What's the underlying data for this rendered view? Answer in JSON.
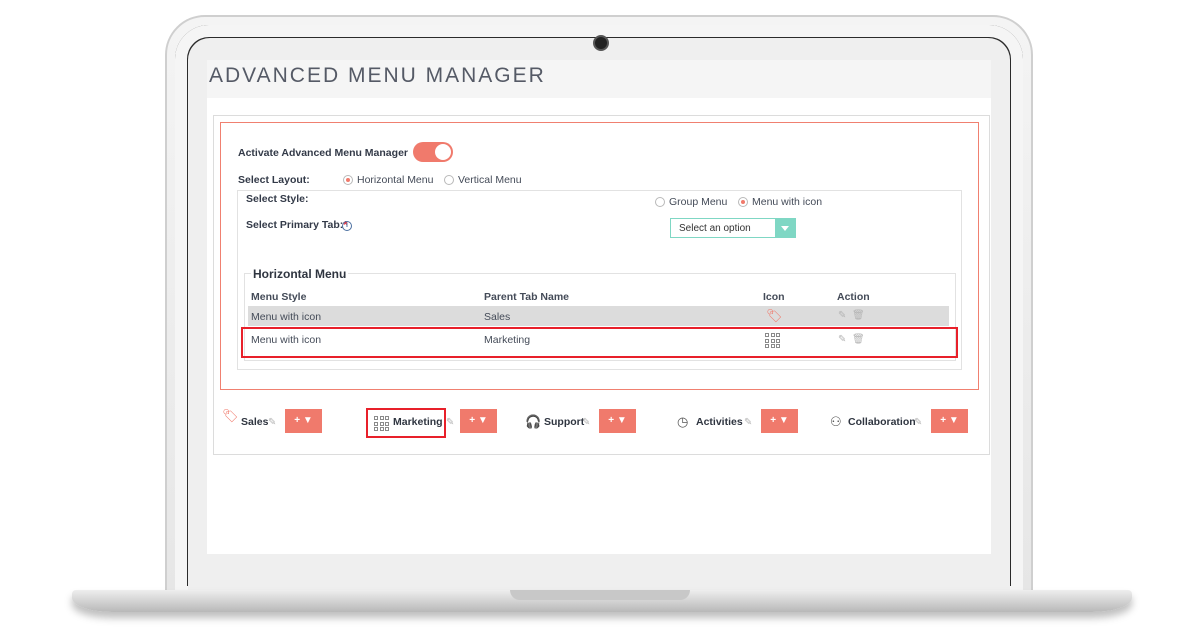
{
  "header": {
    "title": "ADVANCED MENU MANAGER"
  },
  "settings": {
    "activate_label": "Activate Advanced Menu Manager",
    "activate_on": true,
    "layout_label": "Select Layout:",
    "layout_options": [
      "Horizontal Menu",
      "Vertical Menu"
    ],
    "layout_selected": "Horizontal Menu",
    "style_label": "Select Style:",
    "style_options": [
      "Group Menu",
      "Menu with icon"
    ],
    "style_selected": "Menu with icon",
    "primary_tab_label": "Select Primary Tab:",
    "required_mark": "*",
    "info_glyph": "i",
    "primary_tab_placeholder": "Select an option"
  },
  "horizontal_menu": {
    "title": "Horizontal Menu",
    "columns": [
      "Menu Style",
      "Parent Tab Name",
      "Icon",
      "Action"
    ],
    "rows": [
      {
        "menu_style": "Menu with icon",
        "parent_tab": "Sales",
        "icon": "tag-icon"
      },
      {
        "menu_style": "Menu with icon",
        "parent_tab": "Marketing",
        "icon": "grid-icon"
      }
    ]
  },
  "menu_bar": {
    "items": [
      {
        "label": "Sales",
        "icon": "tag-icon"
      },
      {
        "label": "Marketing",
        "icon": "grid-icon"
      },
      {
        "label": "Support",
        "icon": "headset-icon"
      },
      {
        "label": "Activities",
        "icon": "clock-icon"
      },
      {
        "label": "Collaboration",
        "icon": "people-icon"
      }
    ],
    "add_button_label": "+ ▼"
  },
  "colors": {
    "accent": "#f07a6c",
    "highlight": "#e8202a",
    "select_accent": "#7fd7c4"
  }
}
